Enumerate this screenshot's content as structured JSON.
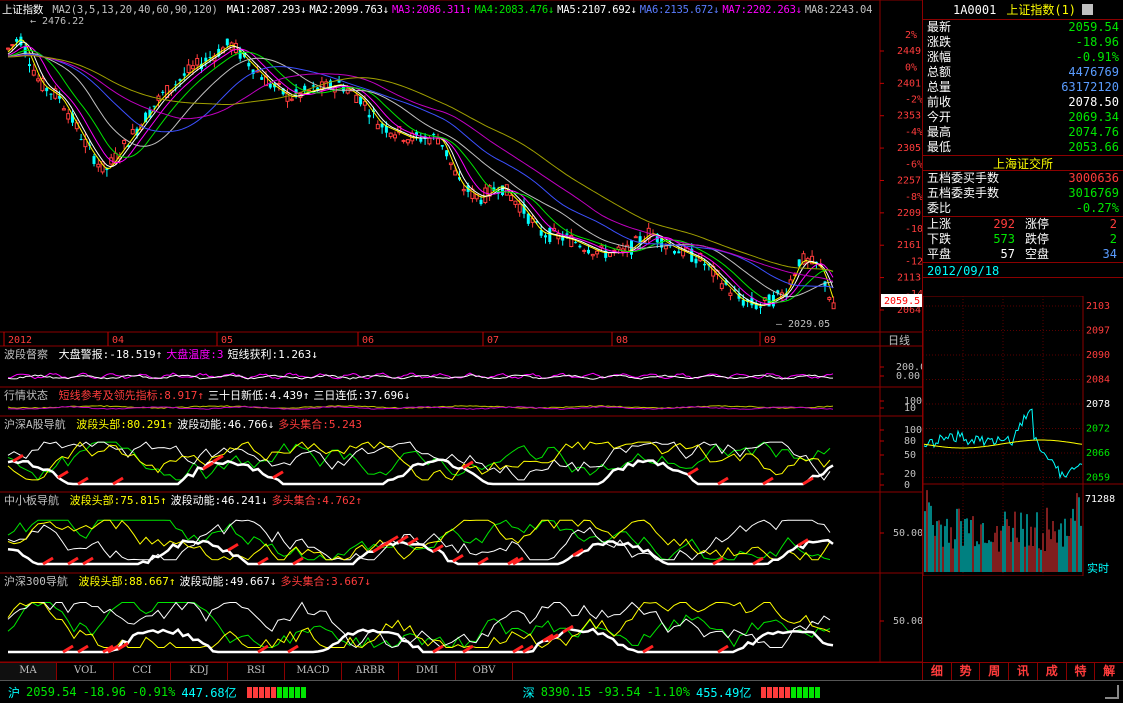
{
  "main_chart": {
    "title": "上证指数",
    "ma_params": "MA2(3,5,13,20,40,60,90,120)",
    "ma_values": [
      {
        "label": "MA1:2087.293",
        "arrow": "↓",
        "color": "#ffffff"
      },
      {
        "label": "MA2:2099.763",
        "arrow": "↓",
        "color": "#ffffff"
      },
      {
        "label": "MA3:2086.311",
        "arrow": "↑",
        "color": "#ff00ff"
      },
      {
        "label": "MA4:2083.476",
        "arrow": "↓",
        "color": "#00e600"
      },
      {
        "label": "MA5:2107.692",
        "arrow": "↓",
        "color": "#ffffff"
      },
      {
        "label": "MA6:2135.672",
        "arrow": "↓",
        "color": "#5a7cff"
      },
      {
        "label": "MA7:2202.263",
        "arrow": "↓",
        "color": "#ff00ff"
      },
      {
        "label": "MA8:2243.04",
        "arrow": "",
        "color": "#c0c0c0"
      }
    ],
    "high_label": "2476.22",
    "low_label": "2029.05",
    "current_price_tag": "2059.5",
    "y_ticks": [
      "2449.1",
      "2401.1",
      "2353.1",
      "2305.1",
      "2257.0",
      "2209.0",
      "2161.0",
      "2113.0",
      "2064.9"
    ],
    "pct_ticks": [
      "2%",
      "0%",
      "-2%",
      "-4%",
      "-6%",
      "-8%",
      "-10%",
      "-12%",
      "-14%"
    ],
    "x_ticks": [
      "2012",
      "04",
      "05",
      "06",
      "07",
      "08",
      "09"
    ],
    "period_label": "日线"
  },
  "indicators": [
    {
      "name": "波段督察",
      "items": [
        {
          "text": "大盘警报:-18.519",
          "arrow": "↑",
          "color": "#ffffff"
        },
        {
          "text": "大盘温度:3",
          "arrow": "",
          "color": "#ff00ff"
        },
        {
          "text": "短线获利:1.263",
          "arrow": "↓",
          "color": "#ffffff"
        }
      ],
      "ticks": [
        "200.00",
        "0.00"
      ]
    },
    {
      "name": "行情状态",
      "items": [
        {
          "text": "短线参考及领先指标:8.917",
          "arrow": "↑",
          "color": "#ff3c3c"
        },
        {
          "text": "三十日新低:4.439",
          "arrow": "↑",
          "color": "#ffffff"
        },
        {
          "text": "三日连低:37.696",
          "arrow": "↓",
          "color": "#ffffff"
        }
      ],
      "ticks": [
        "100",
        "10"
      ]
    },
    {
      "name": "沪深A股导航",
      "items": [
        {
          "text": "波段头部:80.291",
          "arrow": "↑",
          "color": "#ffff00"
        },
        {
          "text": "波段动能:46.766",
          "arrow": "↓",
          "color": "#ffffff"
        },
        {
          "text": "多头集合:5.243",
          "arrow": "",
          "color": "#ff3c3c"
        }
      ],
      "ticks": [
        "100",
        "80",
        "50",
        "20",
        "0"
      ]
    },
    {
      "name": "中小板导航",
      "items": [
        {
          "text": "波段头部:75.815",
          "arrow": "↑",
          "color": "#ffff00"
        },
        {
          "text": "波段动能:46.241",
          "arrow": "↓",
          "color": "#ffffff"
        },
        {
          "text": "多头集合:4.762",
          "arrow": "↑",
          "color": "#ff3c3c"
        }
      ],
      "ticks": [
        "50.00"
      ]
    },
    {
      "name": "沪深300导航",
      "items": [
        {
          "text": "波段头部:88.667",
          "arrow": "↑",
          "color": "#ffff00"
        },
        {
          "text": "波段动能:49.667",
          "arrow": "↓",
          "color": "#ffffff"
        },
        {
          "text": "多头集合:3.667",
          "arrow": "↓",
          "color": "#ff3c3c"
        }
      ],
      "ticks": [
        "50.00"
      ]
    }
  ],
  "bottom_tabs": [
    "MA",
    "VOL",
    "CCI",
    "KDJ",
    "RSI",
    "MACD",
    "ARBR",
    "DMI",
    "OBV"
  ],
  "quote": {
    "code": "1A0001",
    "name": "上证指数",
    "suffix": "(1)",
    "rows": [
      {
        "k": "最新",
        "v": "2059.54",
        "color": "#00e600"
      },
      {
        "k": "涨跌",
        "v": "-18.96",
        "color": "#00e600"
      },
      {
        "k": "涨幅",
        "v": "-0.91%",
        "color": "#00e600"
      },
      {
        "k": "总额",
        "v": "4476769",
        "color": "#5a9cff"
      },
      {
        "k": "总量",
        "v": "63172120",
        "color": "#5a9cff"
      },
      {
        "k": "前收",
        "v": "2078.50",
        "color": "#ffffff"
      },
      {
        "k": "今开",
        "v": "2069.34",
        "color": "#00e600"
      },
      {
        "k": "最高",
        "v": "2074.76",
        "color": "#00e600"
      },
      {
        "k": "最低",
        "v": "2053.66",
        "color": "#00e600"
      }
    ],
    "exchange": "上海证交所",
    "order_rows": [
      {
        "k": "五档委买手数",
        "v": "3000636",
        "color": "#ff3c3c"
      },
      {
        "k": "五档委卖手数",
        "v": "3016769",
        "color": "#00e600"
      },
      {
        "k": "委比",
        "v": "-0.27%",
        "color": "#00e600"
      }
    ],
    "breadth": [
      {
        "k1": "上涨",
        "v1": "292",
        "c1": "#ff3c3c",
        "k2": "涨停",
        "v2": "2",
        "c2": "#ff3c3c"
      },
      {
        "k1": "下跌",
        "v1": "573",
        "c1": "#00e600",
        "k2": "跌停",
        "v2": "2",
        "c2": "#00e600"
      },
      {
        "k1": "平盘",
        "v1": "57",
        "c1": "#ffffff",
        "k2": "空盘",
        "v2": "34",
        "c2": "#5a9cff"
      }
    ],
    "date": "2012/09/18"
  },
  "intraday": {
    "price_ticks": [
      "2103",
      "2097",
      "2090",
      "2084",
      "2078",
      "2072",
      "2066",
      "2059"
    ],
    "volume_max": "71288",
    "volume_label": "实时"
  },
  "right_tabs": [
    "细",
    "势",
    "周",
    "讯",
    "成",
    "特",
    "解"
  ],
  "status_bar": {
    "sh": {
      "name": "沪",
      "price": "2059.54",
      "change": "-18.96",
      "pct": "-0.91%",
      "amount": "447.68亿"
    },
    "sz": {
      "name": "深",
      "price": "8390.15",
      "change": "-93.54",
      "pct": "-1.10%",
      "amount": "455.49亿"
    },
    "colors": {
      "down": "#00e600",
      "up": "#ff3c3c",
      "label": "#00ffff"
    }
  }
}
